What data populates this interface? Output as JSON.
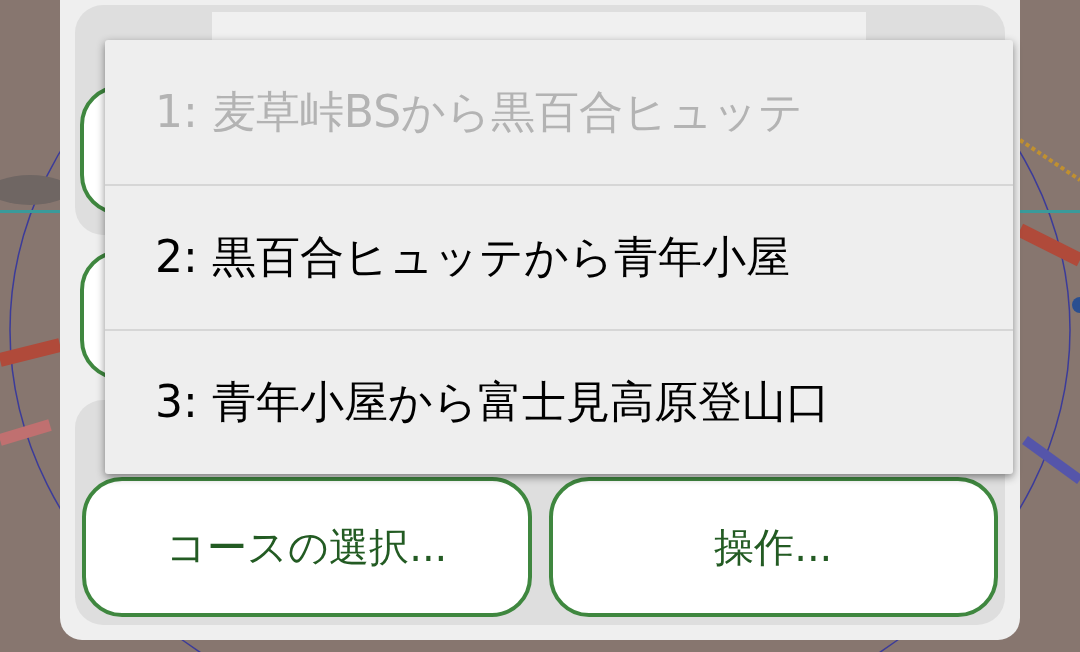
{
  "dialog": {
    "buttons": [
      {
        "label": "コースの選択..."
      },
      {
        "label": "操作..."
      }
    ]
  },
  "menu": {
    "items": [
      {
        "label": "1: 麦草峠BSから黒百合ヒュッテ",
        "disabled": true
      },
      {
        "label": "2: 黒百合ヒュッテから青年小屋",
        "disabled": false
      },
      {
        "label": "3: 青年小屋から富士見高原登山口",
        "disabled": false
      }
    ]
  }
}
